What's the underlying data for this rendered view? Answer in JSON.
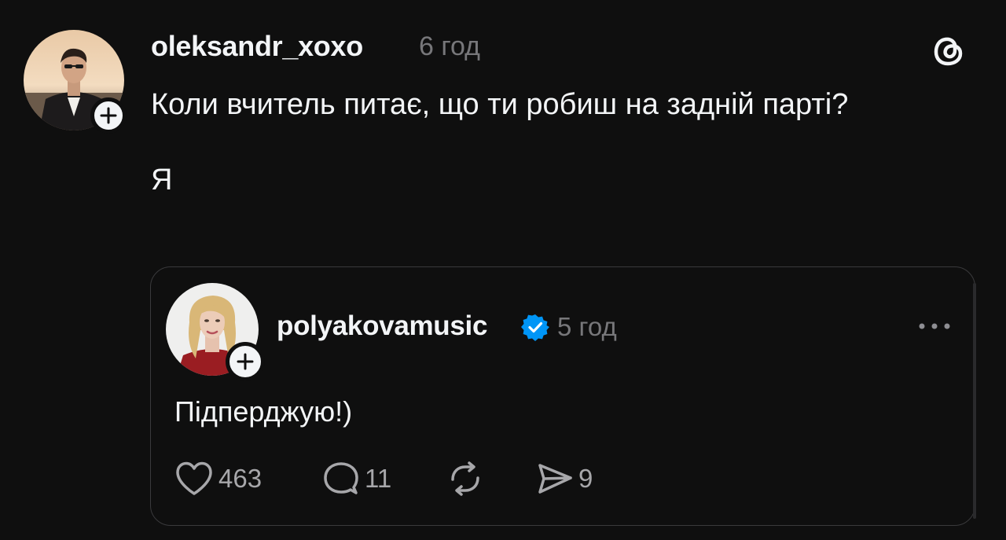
{
  "post": {
    "username": "oleksandr_xoxo",
    "time": "6 год",
    "text_line1": "Коли вчитель питає, що ти робиш на задній парті?",
    "text_line2": "Я",
    "avatar_icon": "user-avatar-man",
    "follow_icon": "plus-icon",
    "logo_icon": "threads-logo-icon"
  },
  "quote": {
    "username": "polyakovamusic",
    "verified_icon": "verified-badge-icon",
    "time": "5 год",
    "text": "Підперджую!)",
    "more_icon": "more-icon",
    "actions": {
      "likes": "463",
      "replies": "11",
      "reposts": "",
      "shares": "9"
    }
  },
  "colors": {
    "background": "#0f0f0f",
    "text_primary": "#f3f5f7",
    "text_secondary": "#77777a",
    "verified": "#0095f6",
    "card_border": "#3a3a3c"
  }
}
